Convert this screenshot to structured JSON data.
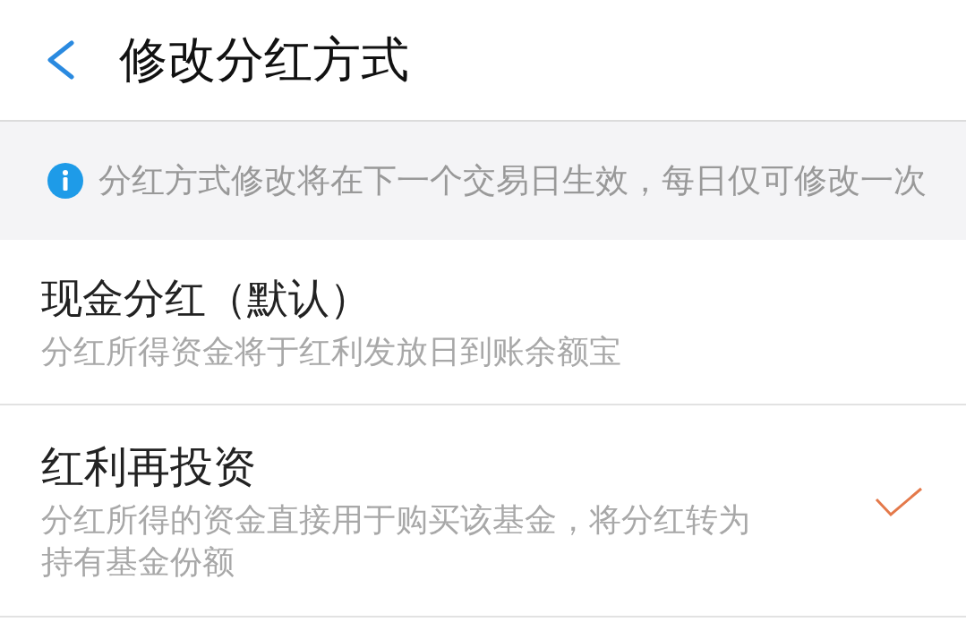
{
  "header": {
    "title": "修改分红方式"
  },
  "notice": {
    "text": "分红方式修改将在下一个交易日生效，每日仅可修改一次"
  },
  "options": [
    {
      "title": "现金分红（默认）",
      "description": "分红所得资金将于红利发放日到账余额宝",
      "selected": false
    },
    {
      "title": "红利再投资",
      "description": "分红所得的资金直接用于购买该基金，将分红转为持有基金份额",
      "selected": true
    }
  ]
}
